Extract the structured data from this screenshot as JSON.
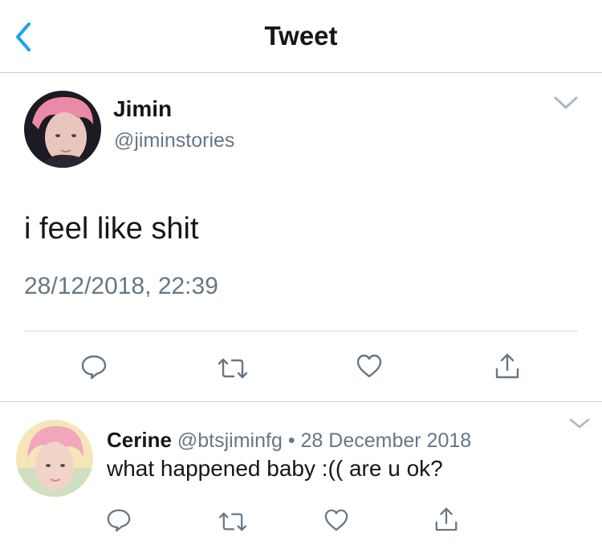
{
  "header": {
    "title": "Tweet"
  },
  "tweet": {
    "display_name": "Jimin",
    "handle": "@jiminstories",
    "text": "i feel like shit",
    "timestamp": "28/12/2018, 22:39"
  },
  "reply": {
    "display_name": "Cerine",
    "handle": "@btsjiminfg",
    "separator": "•",
    "date": "28 December 2018",
    "text": "what happened baby :(( are u ok?"
  },
  "colors": {
    "accent": "#1da1f2",
    "text": "#14171a",
    "secondary": "#657786",
    "icon": "#657786",
    "divider": "#d4d8dc"
  },
  "icons": {
    "back": "chevron-left-icon",
    "menu": "chevron-down-icon",
    "reply": "reply-bubble-icon",
    "retweet": "retweet-icon",
    "like": "heart-icon",
    "share": "share-icon"
  }
}
